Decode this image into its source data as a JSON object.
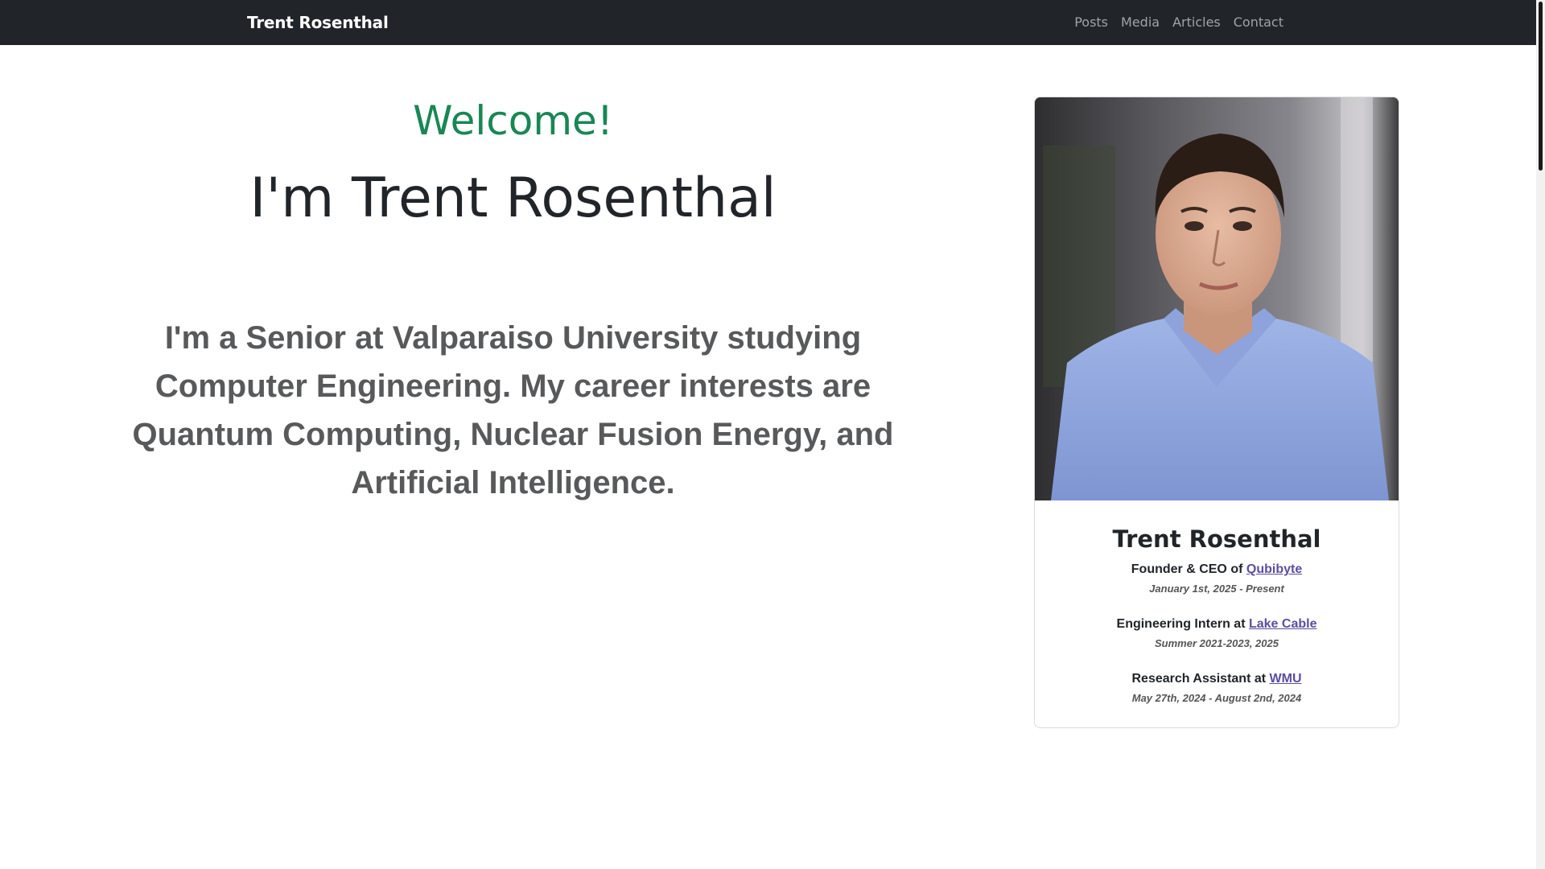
{
  "navbar": {
    "brand": "Trent Rosenthal",
    "links": [
      "Posts",
      "Media",
      "Articles",
      "Contact"
    ]
  },
  "hero": {
    "welcome": "Welcome!",
    "name": "I'm Trent Rosenthal",
    "bio": "I'm a Senior at Valparaiso University studying Computer Engineering. My career interests are Quantum Computing, Nuclear Fusion Energy, and Artificial Intelligence."
  },
  "card": {
    "name": "Trent Rosenthal",
    "roles": [
      {
        "title": "Founder & CEO of",
        "org": "Qubibyte",
        "dates": "January 1st, 2025 - Present"
      },
      {
        "title": "Engineering Intern at",
        "org": "Lake Cable",
        "dates": "Summer 2021-2023, 2025"
      },
      {
        "title": "Research Assistant at",
        "org": "WMU",
        "dates": "May 27th, 2024 - August 2nd, 2024"
      }
    ]
  },
  "colors": {
    "navbar_bg": "#212529",
    "welcome": "#198754",
    "bio_text": "#58595b",
    "link": "#5a4ea0"
  }
}
